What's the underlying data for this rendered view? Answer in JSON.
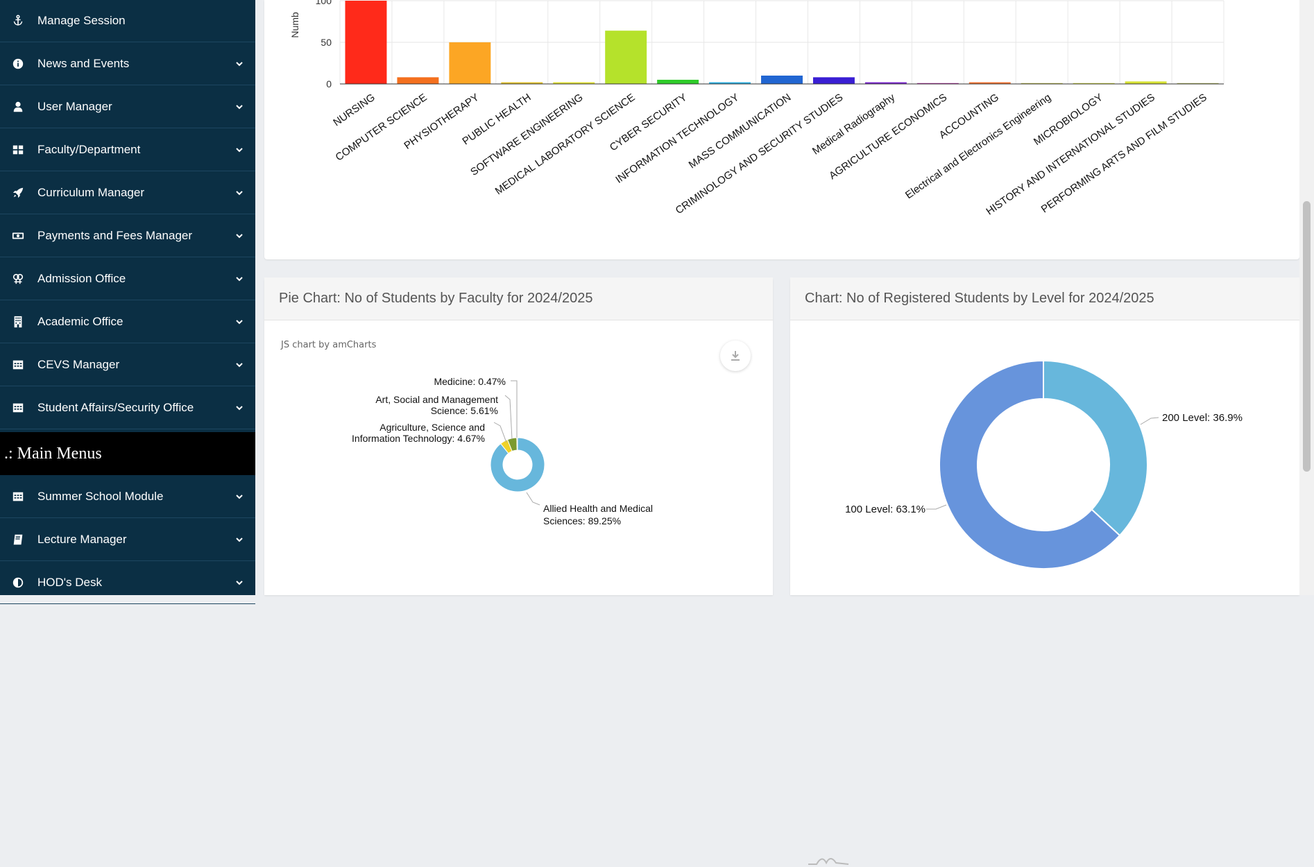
{
  "sidebar": {
    "items": [
      {
        "label": "Manage Session",
        "icon": "anchor-icon"
      },
      {
        "label": "News and Events",
        "icon": "info-icon"
      },
      {
        "label": "User Manager",
        "icon": "user-icon"
      },
      {
        "label": "Faculty/Department",
        "icon": "dashboard-icon"
      },
      {
        "label": "Curriculum Manager",
        "icon": "rocket-icon"
      },
      {
        "label": "Payments and Fees Manager",
        "icon": "money-icon"
      },
      {
        "label": "Admission Office",
        "icon": "gender-icon"
      },
      {
        "label": "Academic Office",
        "icon": "building-icon"
      },
      {
        "label": "CEVS Manager",
        "icon": "table-icon"
      },
      {
        "label": "Student Affairs/Security Office",
        "icon": "table-icon"
      }
    ],
    "section_title": ".: Main Menus",
    "main_items": [
      {
        "label": "Summer School Module",
        "icon": "table-icon"
      },
      {
        "label": "Lecture Manager",
        "icon": "book-icon"
      },
      {
        "label": "HOD's Desk",
        "icon": "adjust-icon"
      }
    ]
  },
  "colors": {
    "sidebar_bg": "#0b2f44",
    "pie_main": "#67b7dc",
    "donut_100": "#6794dc",
    "donut_200": "#67b7dc"
  },
  "chart_data": [
    {
      "type": "bar",
      "ylabel": "Numb",
      "ylim": [
        0,
        100
      ],
      "yticks": [
        "0",
        "50",
        "100"
      ],
      "grid": true,
      "categories": [
        "NURSING",
        "COMPUTER SCIENCE",
        "PHYSIOTHERAPY",
        "PUBLIC HEALTH",
        "SOFTWARE ENGINEERING",
        "MEDICAL LABORATORY SCIENCE",
        "CYBER SECURITY",
        "INFORMATION TECHNOLOGY",
        "MASS COMMUNICATION",
        "CRIMINOLOGY AND SECURITY STUDIES",
        "Medical Radiography",
        "AGRICULTURE ECONOMICS",
        "ACCOUNTING",
        "Electrical and Electronics Engineering",
        "MICROBIOLOGY",
        "HISTORY AND INTERNATIONAL STUDIES",
        "PERFORMING ARTS AND FILM STUDIES"
      ],
      "values": [
        100,
        8,
        50,
        2,
        2,
        64,
        5,
        2,
        10,
        8,
        2,
        1,
        2,
        1,
        1,
        3,
        1
      ],
      "colors": [
        "#ff2a1a",
        "#f4701e",
        "#fca624",
        "#e2c22c",
        "#dfe032",
        "#b5e22b",
        "#2fcc2a",
        "#2aaee0",
        "#2166d2",
        "#3a1fd4",
        "#7b26cf",
        "#b02aa0",
        "#f37332",
        "#c0c040",
        "#d5dc33",
        "#d7e233",
        "#b0b85a"
      ]
    },
    {
      "type": "pie",
      "title": "Pie Chart: No of Students by Faculty for 2024/2025",
      "credit": "JS chart by amCharts",
      "slices": [
        {
          "label": "Allied Health and Medical Sciences: 89.25%",
          "lines": [
            "Allied Health and Medical",
            "Sciences: 89.25%"
          ],
          "value": 89.25,
          "color": "#67b7dc"
        },
        {
          "label": "Agriculture, Science and Information Technology: 4.67%",
          "lines": [
            "Agriculture, Science and",
            "Information Technology: 4.67%"
          ],
          "value": 4.67,
          "color": "#f0d227"
        },
        {
          "label": "Art, Social and Management Science: 5.61%",
          "lines": [
            "Art, Social and Management",
            "Science: 5.61%"
          ],
          "value": 5.61,
          "color": "#7c9a2f"
        },
        {
          "label": "Medicine: 0.47%",
          "lines": [
            "Medicine: 0.47%"
          ],
          "value": 0.47,
          "color": "#546e7a"
        }
      ]
    },
    {
      "type": "pie",
      "title": "Chart: No of Registered Students by Level for 2024/2025",
      "slices": [
        {
          "label": "200 Level: 36.9%",
          "value": 36.9,
          "color": "#67b7dc"
        },
        {
          "label": "100 Level: 63.1%",
          "value": 63.1,
          "color": "#6794dc"
        }
      ]
    }
  ]
}
